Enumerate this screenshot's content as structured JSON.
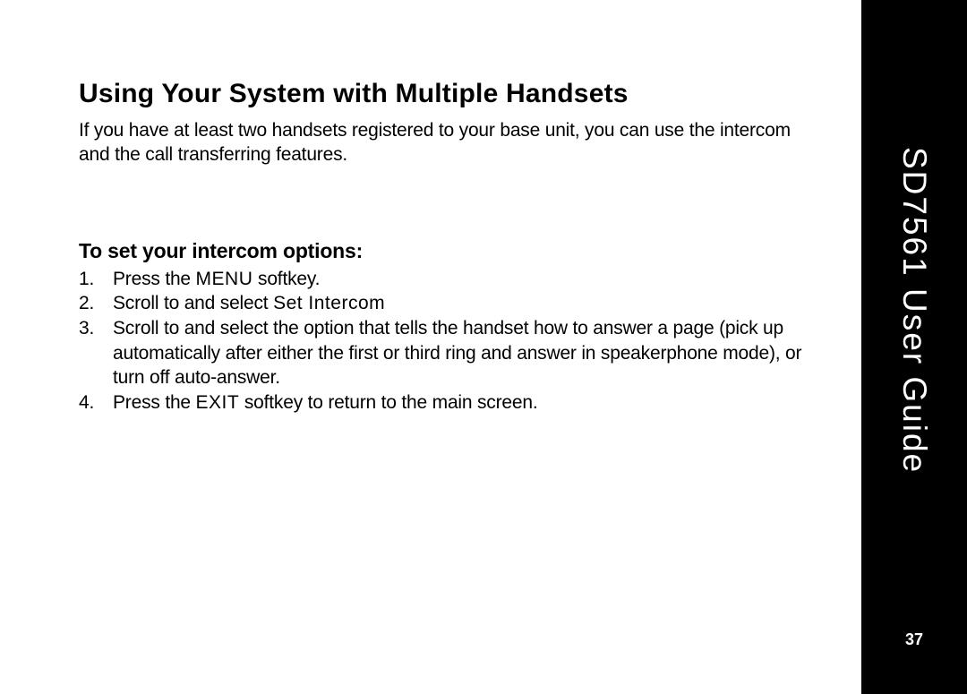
{
  "section_title": "Using Your System with Multiple Handsets",
  "intro_text": "If you have at least two handsets registered to your base unit, you can use the intercom and the call transferring features.",
  "sub_title": "To set your intercom options:",
  "steps": [
    {
      "num": "1.",
      "pre": "Press the ",
      "key": "MENU",
      "post": " softkey."
    },
    {
      "num": "2.",
      "pre": "Scroll to and select ",
      "key": "Set Intercom",
      "post": ""
    },
    {
      "num": "3.",
      "pre": "Scroll to and select the option that tells the handset how to answer a page (pick up automatically after either the first or third ring and answer in speakerphone mode), or turn off auto-answer.",
      "key": "",
      "post": ""
    },
    {
      "num": "4.",
      "pre": "Press the ",
      "key": "EXIT",
      "post": " softkey to return to the main screen."
    }
  ],
  "sidebar_title": "SD7561 User Guide",
  "page_number": "37"
}
